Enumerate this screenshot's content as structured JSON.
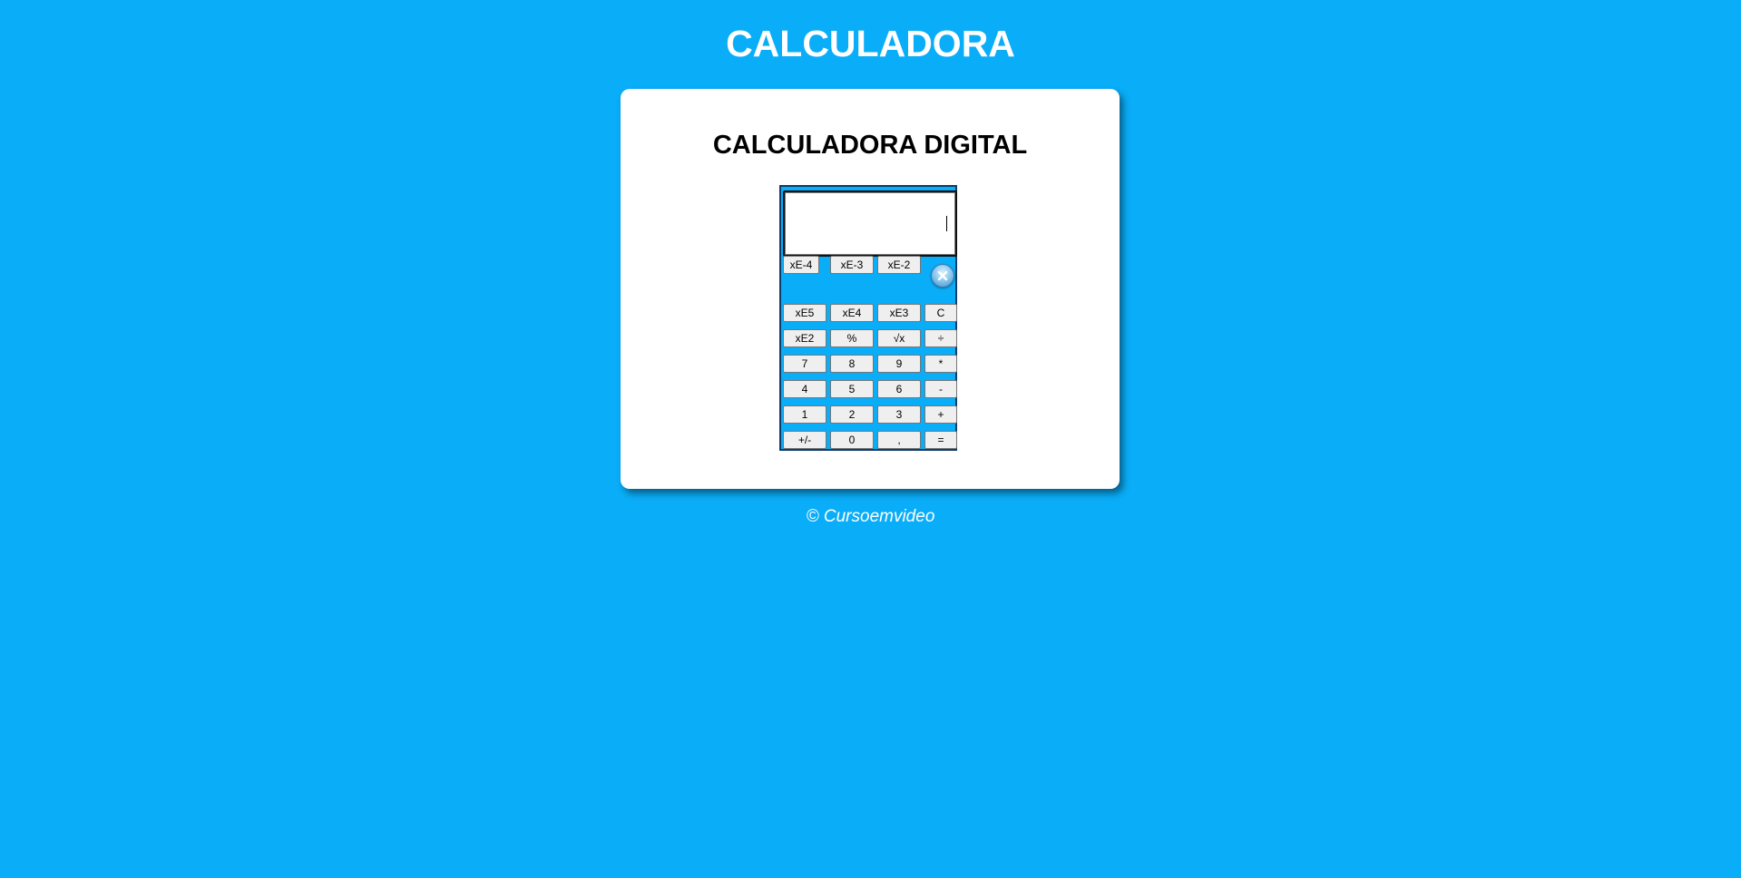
{
  "page": {
    "title": "CALCULADORA",
    "footer": "© Cursoemvideo",
    "background_color": "#0aadf8"
  },
  "card": {
    "title": "CALCULADORA DIGITAL"
  },
  "calculator": {
    "display_value": "",
    "close_icon": "close-icon",
    "keys": {
      "xe_neg4": "xE-4",
      "xe_neg3": "xE-3",
      "xe_neg2": "xE-2",
      "xe5": "xE5",
      "xe4": "xE4",
      "xe3": "xE3",
      "clear": "C",
      "xe2": "xE2",
      "percent": "%",
      "sqrt": "√x",
      "divide": "÷",
      "seven": "7",
      "eight": "8",
      "nine": "9",
      "multiply": "*",
      "four": "4",
      "five": "5",
      "six": "6",
      "minus": "-",
      "one": "1",
      "two": "2",
      "three": "3",
      "plus": "+",
      "sign": "+/-",
      "zero": "0",
      "decimal": ",",
      "equals": "="
    }
  }
}
